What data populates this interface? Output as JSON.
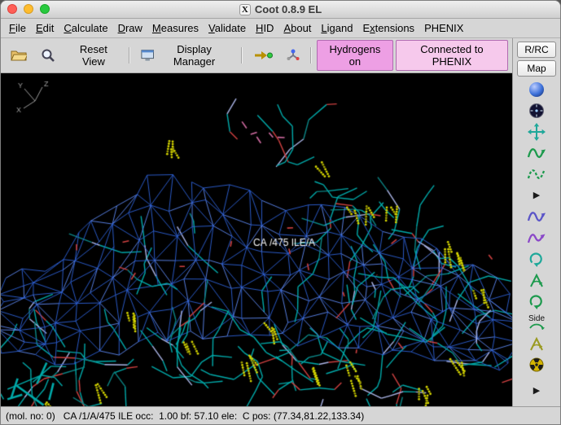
{
  "window": {
    "title": "Coot 0.8.9 EL",
    "icon_glyph": "X"
  },
  "menubar": {
    "items": [
      {
        "label": "File",
        "u": 0
      },
      {
        "label": "Edit",
        "u": 0
      },
      {
        "label": "Calculate",
        "u": 0
      },
      {
        "label": "Draw",
        "u": 0
      },
      {
        "label": "Measures",
        "u": 0
      },
      {
        "label": "Validate",
        "u": 0
      },
      {
        "label": "HID",
        "u": 0
      },
      {
        "label": "About",
        "u": 0
      },
      {
        "label": "Ligand",
        "u": 0
      },
      {
        "label": "Extensions",
        "u": 1
      },
      {
        "label": "PHENIX",
        "u": -1
      }
    ]
  },
  "toolbar": {
    "reset_view_label": "Reset View",
    "display_manager_label": "Display Manager",
    "hydrogens_label": "Hydrogens on",
    "phenix_label": "Connected to PHENIX",
    "hydrogens_bg": "#ed9fe4",
    "phenix_bg": "#f6c9ec",
    "icons": [
      {
        "name": "open-coordinates-icon"
      },
      {
        "name": "magnifier-icon"
      },
      {
        "name": "display-manager-icon"
      },
      {
        "name": "go-to-atom-icon"
      },
      {
        "name": "atom-info-icon"
      }
    ]
  },
  "sidebar": {
    "rrc_label": "R/RC",
    "map_label": "Map",
    "icons": [
      {
        "name": "sphere-icon",
        "kind": "sphere",
        "color": "#3b6fd8"
      },
      {
        "name": "clock-face-icon",
        "kind": "clock",
        "color": "#121232"
      },
      {
        "name": "move-atoms-icon",
        "kind": "cross",
        "color": "#1fa89a"
      },
      {
        "name": "real-space-refine-icon",
        "kind": "coil",
        "color": "#1d9a4d"
      },
      {
        "name": "regularize-zone-icon",
        "kind": "coil-dashed",
        "color": "#1d9a4d"
      },
      {
        "name": "expander-more-icon",
        "kind": "tri",
        "color": "#1a1a1a"
      },
      {
        "name": "rotate-translate-icon",
        "kind": "coil",
        "color": "#5b55c8"
      },
      {
        "name": "auto-fit-rotamer-icon",
        "kind": "coil-arrow",
        "color": "#8a48c8"
      },
      {
        "name": "rotamers-icon",
        "kind": "cycle",
        "color": "#1fa89a"
      },
      {
        "name": "edit-chi-angles-icon",
        "kind": "chi",
        "color": "#1d9a4d"
      },
      {
        "name": "flip-peptide-icon",
        "kind": "cycle",
        "color": "#1d9a4d"
      },
      {
        "name": "side-chain-flip-icon",
        "kind": "side",
        "color": "#1d9a4d",
        "label": "Side"
      },
      {
        "name": "mutate-residue-icon",
        "kind": "chi",
        "color": "#9a9a20"
      },
      {
        "name": "jiggle-fit-icon",
        "kind": "radiation",
        "color": "#d4b400"
      },
      {
        "name": "expander-end-icon",
        "kind": "tri",
        "color": "#1a1a1a"
      }
    ]
  },
  "canvas": {
    "atom_label": "CA /475 ILE/A",
    "axes": [
      "X",
      "Y",
      "Z"
    ],
    "colors": {
      "mesh": "#2c5fd4",
      "mesh_light": "#5b86ee",
      "sticks": "#00a9a9",
      "sticks_dark": "#0b8484",
      "dots": "#d4d400",
      "dots_dark": "#9a9a00",
      "red": "#cf4040",
      "pink": "#cf6aa0",
      "pale": "#aab4e6",
      "label": "#f2f2f2",
      "axes": "#9a9a9a"
    }
  },
  "statusbar": {
    "text": "(mol. no: 0)   CA /1/A/475 ILE occ:  1.00 bf: 57.10 ele:  C pos: (77.34,81.22,133.34)"
  }
}
